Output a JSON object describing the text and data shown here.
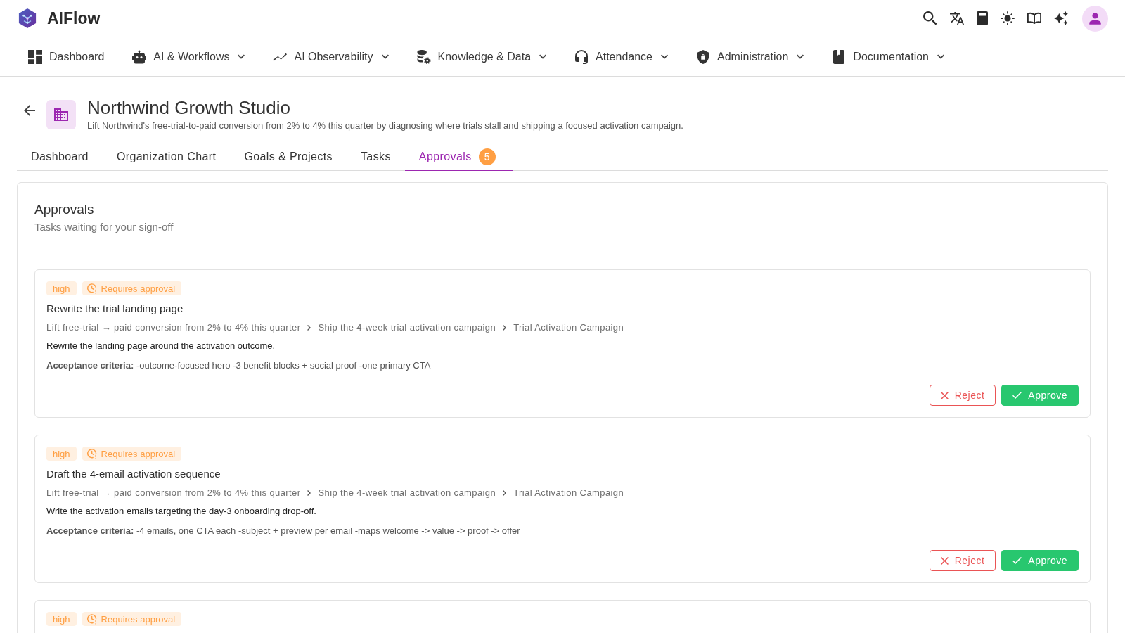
{
  "app": {
    "name": "AIFlow"
  },
  "nav": [
    {
      "label": "Dashboard",
      "has_menu": false
    },
    {
      "label": "AI & Workflows",
      "has_menu": true
    },
    {
      "label": "AI Observability",
      "has_menu": true
    },
    {
      "label": "Knowledge & Data",
      "has_menu": true
    },
    {
      "label": "Attendance",
      "has_menu": true
    },
    {
      "label": "Administration",
      "has_menu": true
    },
    {
      "label": "Documentation",
      "has_menu": true
    }
  ],
  "page": {
    "title": "Northwind Growth Studio",
    "description": "Lift Northwind's free-trial-to-paid conversion from 2% to 4% this quarter by diagnosing where trials stall and shipping a focused activation campaign."
  },
  "tabs": [
    {
      "label": "Dashboard",
      "selected": false
    },
    {
      "label": "Organization Chart",
      "selected": false
    },
    {
      "label": "Goals & Projects",
      "selected": false
    },
    {
      "label": "Tasks",
      "selected": false
    },
    {
      "label": "Approvals",
      "selected": true,
      "badge": "5"
    }
  ],
  "panel": {
    "title": "Approvals",
    "subtitle": "Tasks waiting for your sign-off"
  },
  "approvals": [
    {
      "priority": "high",
      "status": "Requires approval",
      "title": "Rewrite the trial landing page",
      "breadcrumb": [
        "Lift free-trial → paid conversion from 2% to 4% this quarter",
        "Ship the 4-week trial activation campaign",
        "Trial Activation Campaign"
      ],
      "description": "Rewrite the landing page around the activation outcome.",
      "criteria": "**Acceptance criteria:** -outcome-focused hero -3 benefit blocks + social proof -one primary CTA",
      "actions": [
        {
          "label": "Reject",
          "kind": "reject"
        },
        {
          "label": "Approve",
          "kind": "approve"
        }
      ]
    },
    {
      "priority": "high",
      "status": "Requires approval",
      "title": "Draft the 4-email activation sequence",
      "breadcrumb": [
        "Lift free-trial → paid conversion from 2% to 4% this quarter",
        "Ship the 4-week trial activation campaign",
        "Trial Activation Campaign"
      ],
      "description": "Write the activation emails targeting the day-3 onboarding drop-off.",
      "criteria": "**Acceptance criteria:** -4 emails, one CTA each -subject + preview per email -maps welcome -> value -> proof -> offer",
      "actions": [
        {
          "label": "Reject",
          "kind": "reject"
        },
        {
          "label": "Approve",
          "kind": "approve"
        }
      ]
    },
    {
      "priority": "high",
      "status": "Requires approval"
    }
  ]
}
